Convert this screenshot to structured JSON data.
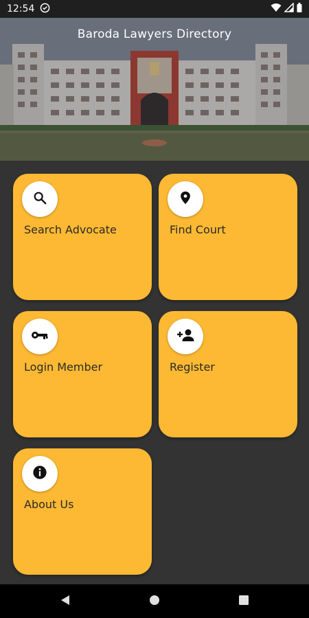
{
  "status_bar": {
    "time": "12:54"
  },
  "header": {
    "title": "Baroda Lawyers Directory"
  },
  "cards": [
    {
      "label": "Search Advocate",
      "icon": "search-icon"
    },
    {
      "label": "Find Court",
      "icon": "location-pin-icon"
    },
    {
      "label": "Login Member",
      "icon": "key-icon"
    },
    {
      "label": "Register",
      "icon": "add-person-icon"
    },
    {
      "label": "About Us",
      "icon": "info-icon"
    }
  ],
  "colors": {
    "card": "#fdb933",
    "background": "#333333"
  }
}
